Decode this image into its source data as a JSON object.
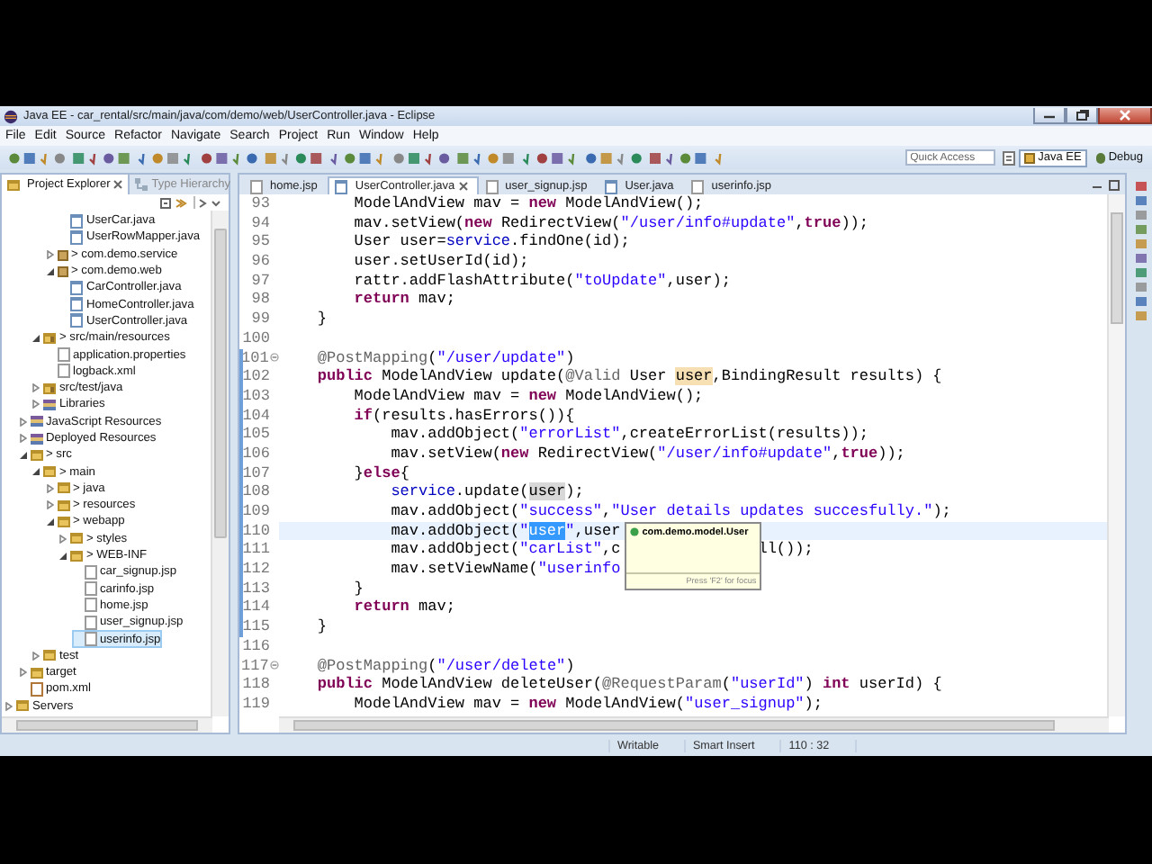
{
  "window": {
    "title": "Java EE - car_rental/src/main/java/com/demo/web/UserController.java - Eclipse"
  },
  "menu": [
    "File",
    "Edit",
    "Source",
    "Refactor",
    "Navigate",
    "Search",
    "Project",
    "Run",
    "Window",
    "Help"
  ],
  "toolbar": {
    "quick_access": {
      "placeholder": "Quick Access"
    },
    "perspectives": [
      {
        "label": "Java EE",
        "selected": true
      },
      {
        "label": "Debug",
        "selected": false
      }
    ]
  },
  "explorer": {
    "tabs": [
      {
        "label": "Project Explorer",
        "selected": true
      },
      {
        "label": "Type Hierarchy",
        "selected": false
      }
    ],
    "tree": [
      {
        "children": [
          {
            "children": [
              {
                "children": [
                  {
                    "children": [
                      {
                        "label": "UserCar.java",
                        "kind": "java",
                        "selected": false
                      },
                      {
                        "label": "UserRowMapper.java",
                        "kind": "java",
                        "selected": false
                      }
                    ]
                  },
                  {
                    "label": "> com.demo.service",
                    "kind": "package",
                    "expanded": false,
                    "selected": false
                  },
                  {
                    "label": "> com.demo.web",
                    "kind": "package",
                    "expanded": true,
                    "selected": false,
                    "children": [
                      {
                        "label": "CarController.java",
                        "kind": "java",
                        "selected": false
                      },
                      {
                        "label": "HomeController.java",
                        "kind": "java",
                        "selected": false
                      },
                      {
                        "label": "UserController.java",
                        "kind": "java",
                        "selected": false
                      }
                    ]
                  }
                ]
              },
              {
                "label": "> src/main/resources",
                "kind": "source-folder",
                "expanded": true,
                "selected": false,
                "children": [
                  {
                    "label": "application.properties",
                    "kind": "file",
                    "selected": false
                  },
                  {
                    "label": "logback.xml",
                    "kind": "file",
                    "selected": false
                  }
                ]
              },
              {
                "label": "src/test/java",
                "kind": "source-folder",
                "expanded": false,
                "selected": false
              },
              {
                "label": "Libraries",
                "kind": "library",
                "expanded": false,
                "selected": false
              }
            ]
          },
          {
            "label": "JavaScript Resources",
            "kind": "library",
            "expanded": false,
            "selected": false
          },
          {
            "label": "Deployed Resources",
            "kind": "library",
            "expanded": false,
            "selected": false
          },
          {
            "label": "> src",
            "kind": "folder",
            "expanded": true,
            "selected": false,
            "children": [
              {
                "label": "> main",
                "kind": "folder",
                "expanded": true,
                "selected": false,
                "children": [
                  {
                    "label": "> java",
                    "kind": "folder",
                    "expanded": false,
                    "selected": false
                  },
                  {
                    "label": "> resources",
                    "kind": "folder",
                    "expanded": false,
                    "selected": false
                  },
                  {
                    "label": "> webapp",
                    "kind": "folder",
                    "expanded": true,
                    "selected": false,
                    "children": [
                      {
                        "label": "> styles",
                        "kind": "folder",
                        "expanded": false,
                        "selected": false
                      },
                      {
                        "label": "> WEB-INF",
                        "kind": "folder",
                        "expanded": true,
                        "selected": false,
                        "children": [
                          {
                            "label": "car_signup.jsp",
                            "kind": "file",
                            "selected": false
                          },
                          {
                            "label": "carinfo.jsp",
                            "kind": "file",
                            "selected": false
                          },
                          {
                            "label": "home.jsp",
                            "kind": "file",
                            "selected": false
                          },
                          {
                            "label": "user_signup.jsp",
                            "kind": "file",
                            "selected": false
                          },
                          {
                            "label": "userinfo.jsp",
                            "kind": "file",
                            "selected": true
                          }
                        ]
                      }
                    ]
                  }
                ]
              },
              {
                "label": "test",
                "kind": "folder",
                "expanded": false,
                "selected": false
              }
            ]
          },
          {
            "label": "target",
            "kind": "folder",
            "expanded": false,
            "selected": false
          },
          {
            "label": "pom.xml",
            "kind": "xml",
            "selected": false
          }
        ]
      },
      {
        "label": "Servers",
        "kind": "folder",
        "expanded": false,
        "selected": false
      }
    ]
  },
  "editor": {
    "tabs": [
      {
        "label": "home.jsp",
        "kind": "jsp",
        "selected": false
      },
      {
        "label": "UserController.java",
        "kind": "java",
        "selected": true
      },
      {
        "label": "user_signup.jsp",
        "kind": "jsp",
        "selected": false
      },
      {
        "label": "User.java",
        "kind": "java",
        "selected": false
      },
      {
        "label": "userinfo.jsp",
        "kind": "jsp",
        "selected": false
      }
    ],
    "hover": {
      "title": "com.demo.model.User",
      "hint": "Press 'F2' for focus"
    },
    "lines": [
      {
        "number": "93",
        "changed": false,
        "fold": false,
        "current": false,
        "tokens": [
          {
            "kind": "plain",
            "text": "        ModelAndView mav = "
          },
          {
            "kind": "keyword",
            "text": "new"
          },
          {
            "kind": "plain",
            "text": " ModelAndView();"
          }
        ]
      },
      {
        "number": "94",
        "changed": false,
        "fold": false,
        "current": false,
        "tokens": [
          {
            "kind": "plain",
            "text": "        mav.setView("
          },
          {
            "kind": "keyword",
            "text": "new"
          },
          {
            "kind": "plain",
            "text": " RedirectView("
          },
          {
            "kind": "string",
            "text": "\"/user/info#update\""
          },
          {
            "kind": "plain",
            "text": ","
          },
          {
            "kind": "keyword",
            "text": "true"
          },
          {
            "kind": "plain",
            "text": "));"
          }
        ]
      },
      {
        "number": "95",
        "changed": false,
        "fold": false,
        "current": false,
        "tokens": [
          {
            "kind": "plain",
            "text": "        User user="
          },
          {
            "kind": "field",
            "text": "service"
          },
          {
            "kind": "plain",
            "text": ".findOne(id);"
          }
        ]
      },
      {
        "number": "96",
        "changed": false,
        "fold": false,
        "current": false,
        "tokens": [
          {
            "kind": "plain",
            "text": "        user.setUserId(id);"
          }
        ]
      },
      {
        "number": "97",
        "changed": false,
        "fold": false,
        "current": false,
        "tokens": [
          {
            "kind": "plain",
            "text": "        rattr.addFlashAttribute("
          },
          {
            "kind": "string",
            "text": "\"toUpdate\""
          },
          {
            "kind": "plain",
            "text": ",user);"
          }
        ]
      },
      {
        "number": "98",
        "changed": false,
        "fold": false,
        "current": false,
        "tokens": [
          {
            "kind": "keyword",
            "text": "        return"
          },
          {
            "kind": "plain",
            "text": " mav;"
          }
        ]
      },
      {
        "number": "99",
        "changed": false,
        "fold": false,
        "current": false,
        "tokens": [
          {
            "kind": "plain",
            "text": "    }"
          }
        ]
      },
      {
        "number": "100",
        "changed": false,
        "fold": false,
        "current": false
      },
      {
        "number": "101",
        "changed": true,
        "fold": true,
        "current": false,
        "tokens": [
          {
            "kind": "annotation",
            "text": "    @PostMapping"
          },
          {
            "kind": "plain",
            "text": "("
          },
          {
            "kind": "string",
            "text": "\"/user/update\""
          },
          {
            "kind": "plain",
            "text": ")"
          }
        ]
      },
      {
        "number": "102",
        "changed": true,
        "fold": false,
        "current": false,
        "tokens": [
          {
            "kind": "keyword",
            "text": "    public"
          },
          {
            "kind": "plain",
            "text": " ModelAndView update("
          },
          {
            "kind": "annotation",
            "text": "@Valid"
          },
          {
            "kind": "plain",
            "text": " User "
          },
          {
            "kind": "write-occurrence",
            "text": "user"
          },
          {
            "kind": "plain",
            "text": ",BindingResult results) {"
          }
        ]
      },
      {
        "number": "103",
        "changed": true,
        "fold": false,
        "current": false,
        "tokens": [
          {
            "kind": "plain",
            "text": "        ModelAndView mav = "
          },
          {
            "kind": "keyword",
            "text": "new"
          },
          {
            "kind": "plain",
            "text": " ModelAndView();"
          }
        ]
      },
      {
        "number": "104",
        "changed": true,
        "fold": false,
        "current": false,
        "tokens": [
          {
            "kind": "keyword",
            "text": "        if"
          },
          {
            "kind": "plain",
            "text": "(results.hasErrors()){"
          }
        ]
      },
      {
        "number": "105",
        "changed": true,
        "fold": false,
        "current": false,
        "tokens": [
          {
            "kind": "plain",
            "text": "            mav.addObject("
          },
          {
            "kind": "string",
            "text": "\"errorList\""
          },
          {
            "kind": "plain",
            "text": ",createErrorList(results));"
          }
        ]
      },
      {
        "number": "106",
        "changed": true,
        "fold": false,
        "current": false,
        "tokens": [
          {
            "kind": "plain",
            "text": "            mav.setView("
          },
          {
            "kind": "keyword",
            "text": "new"
          },
          {
            "kind": "plain",
            "text": " RedirectView("
          },
          {
            "kind": "string",
            "text": "\"/user/info#update\""
          },
          {
            "kind": "plain",
            "text": ","
          },
          {
            "kind": "keyword",
            "text": "true"
          },
          {
            "kind": "plain",
            "text": "));"
          }
        ]
      },
      {
        "number": "107",
        "changed": true,
        "fold": false,
        "current": false,
        "tokens": [
          {
            "kind": "plain",
            "text": "        }"
          },
          {
            "kind": "keyword",
            "text": "else"
          },
          {
            "kind": "plain",
            "text": "{"
          }
        ]
      },
      {
        "number": "108",
        "changed": true,
        "fold": false,
        "current": false,
        "tokens": [
          {
            "kind": "field",
            "text": "            service"
          },
          {
            "kind": "plain",
            "text": ".update("
          },
          {
            "kind": "read-occurrence",
            "text": "user"
          },
          {
            "kind": "plain",
            "text": ");"
          }
        ]
      },
      {
        "number": "109",
        "changed": true,
        "fold": false,
        "current": false,
        "tokens": [
          {
            "kind": "plain",
            "text": "            mav.addObject("
          },
          {
            "kind": "string",
            "text": "\"success\""
          },
          {
            "kind": "plain",
            "text": ","
          },
          {
            "kind": "string",
            "text": "\"User details updates succesfully.\""
          },
          {
            "kind": "plain",
            "text": ");"
          }
        ]
      },
      {
        "number": "110",
        "changed": true,
        "fold": false,
        "current": true,
        "tokens": [
          {
            "kind": "plain",
            "text": "            mav.addObject("
          },
          {
            "kind": "string",
            "text": "\""
          },
          {
            "kind": "selection",
            "text": "user"
          },
          {
            "kind": "string",
            "text": "\""
          },
          {
            "kind": "plain",
            "text": ",user"
          }
        ]
      },
      {
        "number": "111",
        "changed": true,
        "fold": false,
        "current": false,
        "tokens": [
          {
            "kind": "plain",
            "text": "            mav.addObject("
          },
          {
            "kind": "string",
            "text": "\"carList\""
          },
          {
            "kind": "plain",
            "text": ",c"
          }
        ],
        "tail": [
          {
            "kind": "plain",
            "text": "ll());"
          }
        ]
      },
      {
        "number": "112",
        "changed": true,
        "fold": false,
        "current": false,
        "tokens": [
          {
            "kind": "plain",
            "text": "            mav.setViewName("
          },
          {
            "kind": "string",
            "text": "\"userinfo"
          }
        ]
      },
      {
        "number": "113",
        "changed": true,
        "fold": false,
        "current": false,
        "tokens": [
          {
            "kind": "plain",
            "text": "        }"
          }
        ]
      },
      {
        "number": "114",
        "changed": true,
        "fold": false,
        "current": false,
        "tokens": [
          {
            "kind": "keyword",
            "text": "        return"
          },
          {
            "kind": "plain",
            "text": " mav;"
          }
        ]
      },
      {
        "number": "115",
        "changed": true,
        "fold": false,
        "current": false,
        "tokens": [
          {
            "kind": "plain",
            "text": "    }"
          }
        ]
      },
      {
        "number": "116",
        "changed": false,
        "fold": false,
        "current": false
      },
      {
        "number": "117",
        "changed": false,
        "fold": true,
        "current": false,
        "tokens": [
          {
            "kind": "annotation",
            "text": "    @PostMapping"
          },
          {
            "kind": "plain",
            "text": "("
          },
          {
            "kind": "string",
            "text": "\"/user/delete\""
          },
          {
            "kind": "plain",
            "text": ")"
          }
        ]
      },
      {
        "number": "118",
        "changed": false,
        "fold": false,
        "current": false,
        "tokens": [
          {
            "kind": "keyword",
            "text": "    public"
          },
          {
            "kind": "plain",
            "text": " ModelAndView deleteUser("
          },
          {
            "kind": "annotation",
            "text": "@RequestParam"
          },
          {
            "kind": "plain",
            "text": "("
          },
          {
            "kind": "string",
            "text": "\"userId\""
          },
          {
            "kind": "plain",
            "text": ") "
          },
          {
            "kind": "keyword",
            "text": "int"
          },
          {
            "kind": "plain",
            "text": " userId) {"
          }
        ]
      },
      {
        "number": "119",
        "changed": false,
        "fold": false,
        "current": false,
        "tokens": [
          {
            "kind": "plain",
            "text": "        ModelAndView mav = "
          },
          {
            "kind": "keyword",
            "text": "new"
          },
          {
            "kind": "plain",
            "text": " ModelAndView("
          },
          {
            "kind": "string",
            "text": "\"user_signup\""
          },
          {
            "kind": "plain",
            "text": ");"
          }
        ]
      }
    ]
  },
  "status_bar": [
    "Writable",
    "Smart Insert",
    "110 : 32"
  ]
}
